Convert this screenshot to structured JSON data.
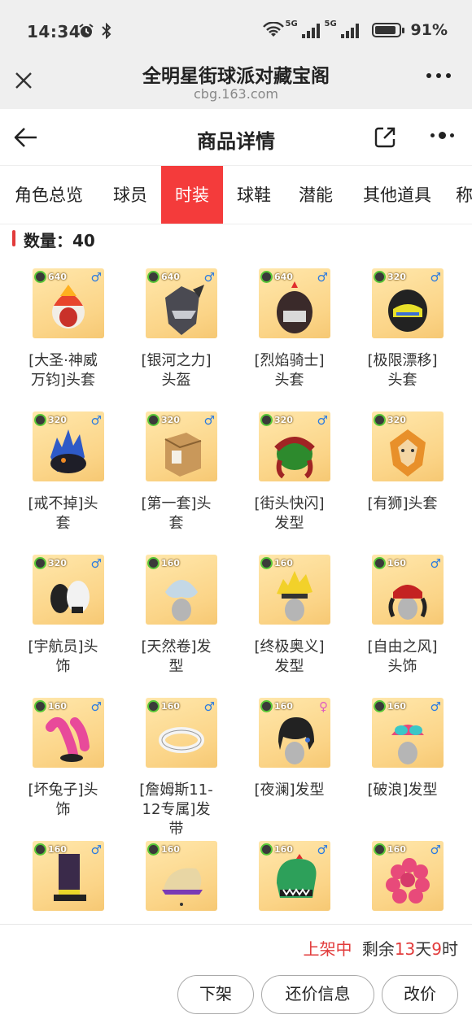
{
  "status_bar": {
    "time": "14:34",
    "network_1": "5G",
    "network_2": "5G",
    "battery": "91%",
    "battery_level": 0.91
  },
  "browser": {
    "title": "全明星街球派对藏宝阁",
    "url": "cbg.163.com"
  },
  "header": {
    "title": "商品详情"
  },
  "tabs": [
    {
      "label": "角色总览"
    },
    {
      "label": "球员"
    },
    {
      "label": "时装",
      "active": true
    },
    {
      "label": "球鞋"
    },
    {
      "label": "潜能"
    },
    {
      "label": "其他道具"
    },
    {
      "label": "称"
    }
  ],
  "count_label": "数量：40",
  "items": [
    {
      "name": "[大圣·神威万钧]头套",
      "points": "640",
      "gender": "♂",
      "icon": "monkey-king-helmet"
    },
    {
      "name": "[银河之力]头盔",
      "points": "640",
      "gender": "♂",
      "icon": "silver-armor-helmet"
    },
    {
      "name": "[烈焰骑士]头套",
      "points": "640",
      "gender": "♂",
      "icon": "flame-knight-helmet"
    },
    {
      "name": "[极限漂移]头套",
      "points": "320",
      "gender": "♂",
      "icon": "racing-helmet"
    },
    {
      "name": "[戒不掉]头套",
      "points": "320",
      "gender": "♂",
      "icon": "spiky-monster-helmet"
    },
    {
      "name": "[第一套]头套",
      "points": "320",
      "gender": "♂",
      "icon": "cardboard-box-helmet"
    },
    {
      "name": "[街头快闪]发型",
      "points": "320",
      "gender": "♂",
      "icon": "dreadlocks-hair"
    },
    {
      "name": "[有狮]头套",
      "points": "320",
      "gender": "",
      "icon": "lion-helmet"
    },
    {
      "name": "[宇航员]头饰",
      "points": "320",
      "gender": "♂",
      "icon": "astronaut-headwear"
    },
    {
      "name": "[天然卷]发型",
      "points": "160",
      "gender": "",
      "icon": "curly-hair"
    },
    {
      "name": "[终极奥义]发型",
      "points": "160",
      "gender": "",
      "icon": "spiky-blonde-hair"
    },
    {
      "name": "[自由之风]头饰",
      "points": "160",
      "gender": "♂",
      "icon": "bandana-headwear"
    },
    {
      "name": "[坏兔子]头饰",
      "points": "160",
      "gender": "♂",
      "icon": "bunny-ears-headwear"
    },
    {
      "name": "[詹姆斯11-12专属]发带",
      "points": "160",
      "gender": "♂",
      "icon": "headband"
    },
    {
      "name": "[夜澜]发型",
      "points": "160",
      "gender": "♀",
      "icon": "black-bob-hair"
    },
    {
      "name": "[破浪]发型",
      "points": "160",
      "gender": "♂",
      "icon": "goggles-hair"
    },
    {
      "name": "",
      "points": "160",
      "gender": "♂",
      "icon": "tall-hat"
    },
    {
      "name": "",
      "points": "160",
      "gender": "",
      "icon": "purple-cap"
    },
    {
      "name": "",
      "points": "160",
      "gender": "♂",
      "icon": "dinosaur-helmet"
    },
    {
      "name": "",
      "points": "160",
      "gender": "♂",
      "icon": "pink-curly-hair"
    }
  ],
  "listing": {
    "status": "上架中",
    "remaining_prefix": "剩余",
    "days": "13",
    "days_unit": "天",
    "hours": "9",
    "hours_unit": "时"
  },
  "buttons": {
    "delist": "下架",
    "counter_offer": "还价信息",
    "change_price": "改价"
  },
  "colors": {
    "accent": "#f43b3b",
    "card_bg": "#fbd487",
    "male": "#2b7be0",
    "female": "#e05bbf"
  }
}
